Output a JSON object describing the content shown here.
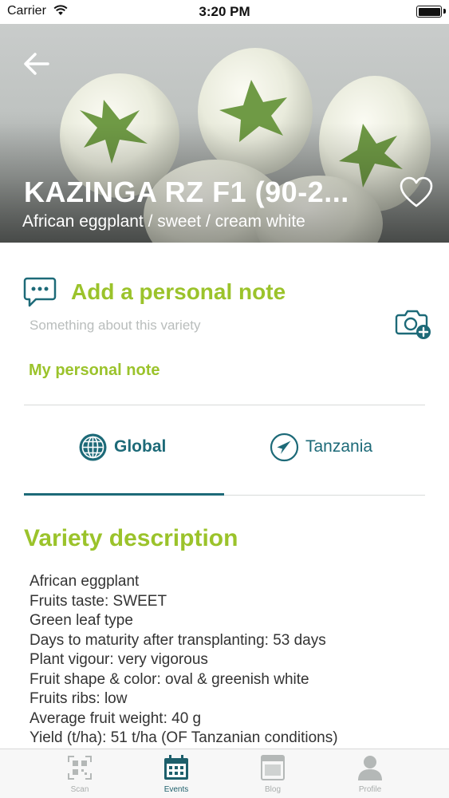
{
  "status_bar": {
    "carrier": "Carrier",
    "time": "3:20 PM"
  },
  "hero": {
    "title": "KAZINGA RZ F1 (90-2...",
    "subtitle": "African eggplant / sweet / cream white"
  },
  "note": {
    "title": "Add a personal note",
    "placeholder": "Something about this variety",
    "link_label": "My personal note"
  },
  "tabs": [
    {
      "label": "Global",
      "active": true,
      "icon": "globe-icon"
    },
    {
      "label": "Tanzania",
      "active": false,
      "icon": "location-arrow-icon"
    }
  ],
  "description": {
    "title": "Variety description",
    "items": [
      "African eggplant",
      "Fruits taste: SWEET",
      "Green leaf type",
      "Days to maturity after transplanting: 53 days",
      "Plant vigour: very vigorous",
      "Fruit shape & color: oval & greenish white",
      "Fruits ribs: low",
      "Average fruit weight: 40 g",
      "Yield (t/ha): 51 t/ha (OF Tanzanian conditions)"
    ]
  },
  "tabbar": {
    "items": [
      {
        "label": "Scan",
        "icon": "qr-code-icon",
        "active": false
      },
      {
        "label": "Events",
        "icon": "calendar-icon",
        "active": true
      },
      {
        "label": "Blog",
        "icon": "blog-icon",
        "active": false
      },
      {
        "label": "Profile",
        "icon": "profile-icon",
        "active": false
      }
    ]
  },
  "colors": {
    "accent_green": "#9bc32b",
    "teal": "#1d6a78",
    "placeholder_gray": "#b9bdbc"
  }
}
